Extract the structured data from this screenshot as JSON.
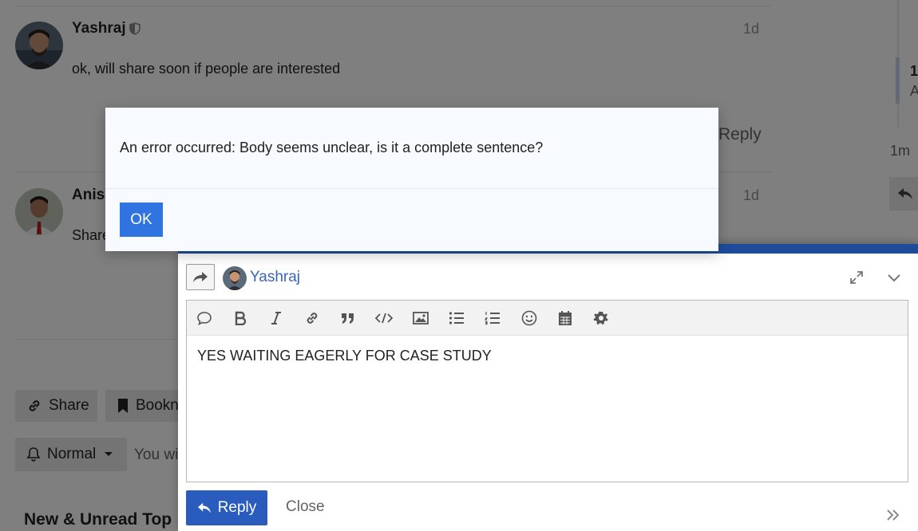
{
  "posts": [
    {
      "username": "Yashraj",
      "date": "1d",
      "body": "ok, will share soon if people are interested",
      "reply_label": "Reply"
    },
    {
      "username": "Anis",
      "date": "1d",
      "body": "Share"
    }
  ],
  "timeline": {
    "top_label": "1",
    "sub_label": "A",
    "ago": "1m"
  },
  "topic_footer": {
    "share_label": "Share",
    "bookmark_label": "Bookn",
    "notify_label": "Normal",
    "notify_hint": "You wi"
  },
  "suggested": {
    "heading": "New & Unread Top"
  },
  "composer": {
    "username": "Yashraj",
    "body_text": "YES WAITING EAGERLY FOR CASE STUDY",
    "reply_label": "Reply",
    "close_label": "Close"
  },
  "dialog": {
    "message": "An error occurred: Body seems unclear, is it a complete sentence?",
    "ok_label": "OK"
  },
  "colors": {
    "accent": "#2f74e0",
    "composer_bar": "#1e4c9a",
    "reply_button": "#2a5cbd"
  }
}
